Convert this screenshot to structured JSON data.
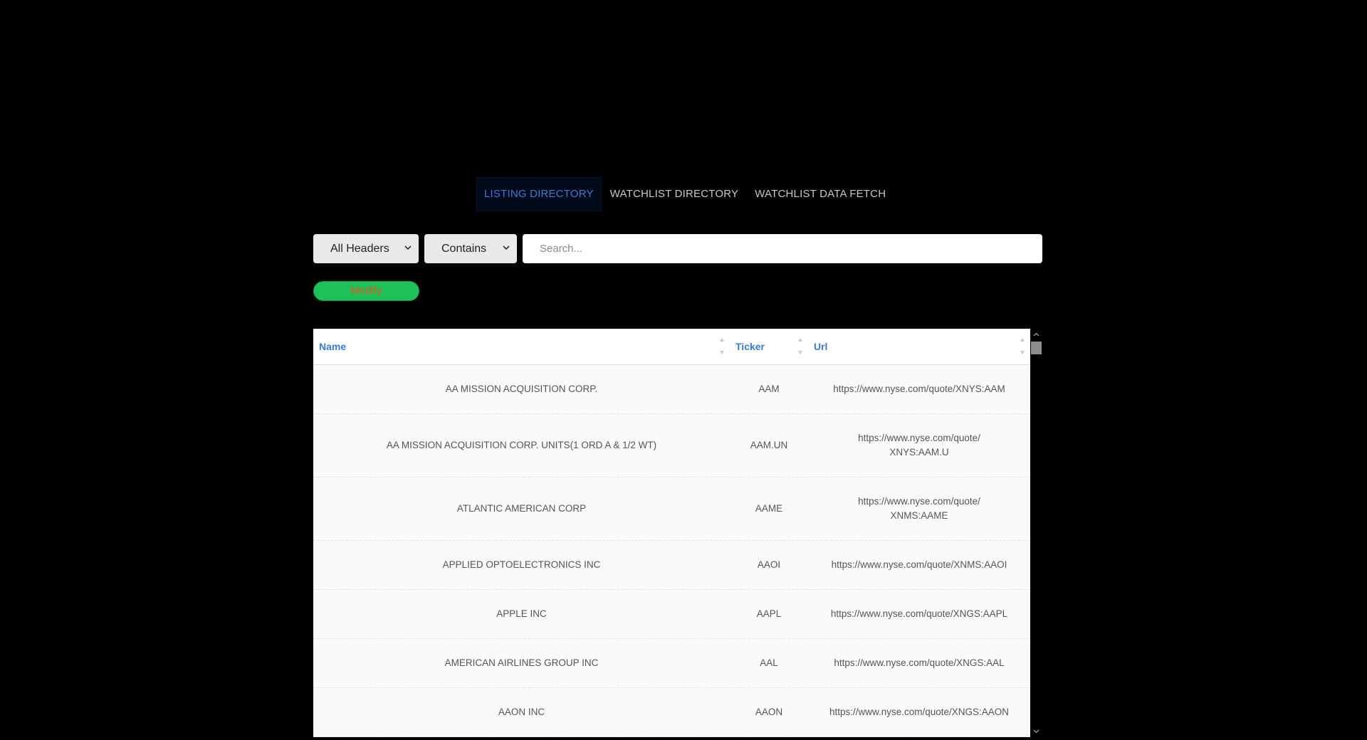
{
  "nav": {
    "items": [
      {
        "label": "LISTING DIRECTORY",
        "active": true
      },
      {
        "label": "WATCHLIST DIRECTORY",
        "active": false
      },
      {
        "label": "WATCHLIST DATA FETCH",
        "active": false
      }
    ]
  },
  "filters": {
    "header_select": "All Headers",
    "operator_select": "Contains",
    "search_placeholder": "Search..."
  },
  "modify_label": "Modify",
  "colors": {
    "accent": "#3a7bd5",
    "modify_bg": "#1ec05a",
    "modify_text": "#e8551f"
  },
  "table": {
    "headers": [
      "Name",
      "Ticker",
      "Url"
    ],
    "rows": [
      {
        "name": "AA MISSION ACQUISITION CORP.",
        "ticker": "AAM",
        "url": "https://www.nyse.com/quote/XNYS:AAM"
      },
      {
        "name": "AA MISSION ACQUISITION CORP. UNITS(1 ORD A & 1/2 WT)",
        "ticker": "AAM.UN",
        "url_line1": "https://www.nyse.com/quote/",
        "url_line2": "XNYS:AAM.U"
      },
      {
        "name": "ATLANTIC AMERICAN CORP",
        "ticker": "AAME",
        "url_line1": "https://www.nyse.com/quote/",
        "url_line2": "XNMS:AAME"
      },
      {
        "name": "APPLIED OPTOELECTRONICS INC",
        "ticker": "AAOI",
        "url": "https://www.nyse.com/quote/XNMS:AAOI"
      },
      {
        "name": "APPLE INC",
        "ticker": "AAPL",
        "url": "https://www.nyse.com/quote/XNGS:AAPL"
      },
      {
        "name": "AMERICAN AIRLINES GROUP INC",
        "ticker": "AAL",
        "url": "https://www.nyse.com/quote/XNGS:AAL"
      },
      {
        "name": "AAON INC",
        "ticker": "AAON",
        "url": "https://www.nyse.com/quote/XNGS:AAON"
      }
    ]
  }
}
